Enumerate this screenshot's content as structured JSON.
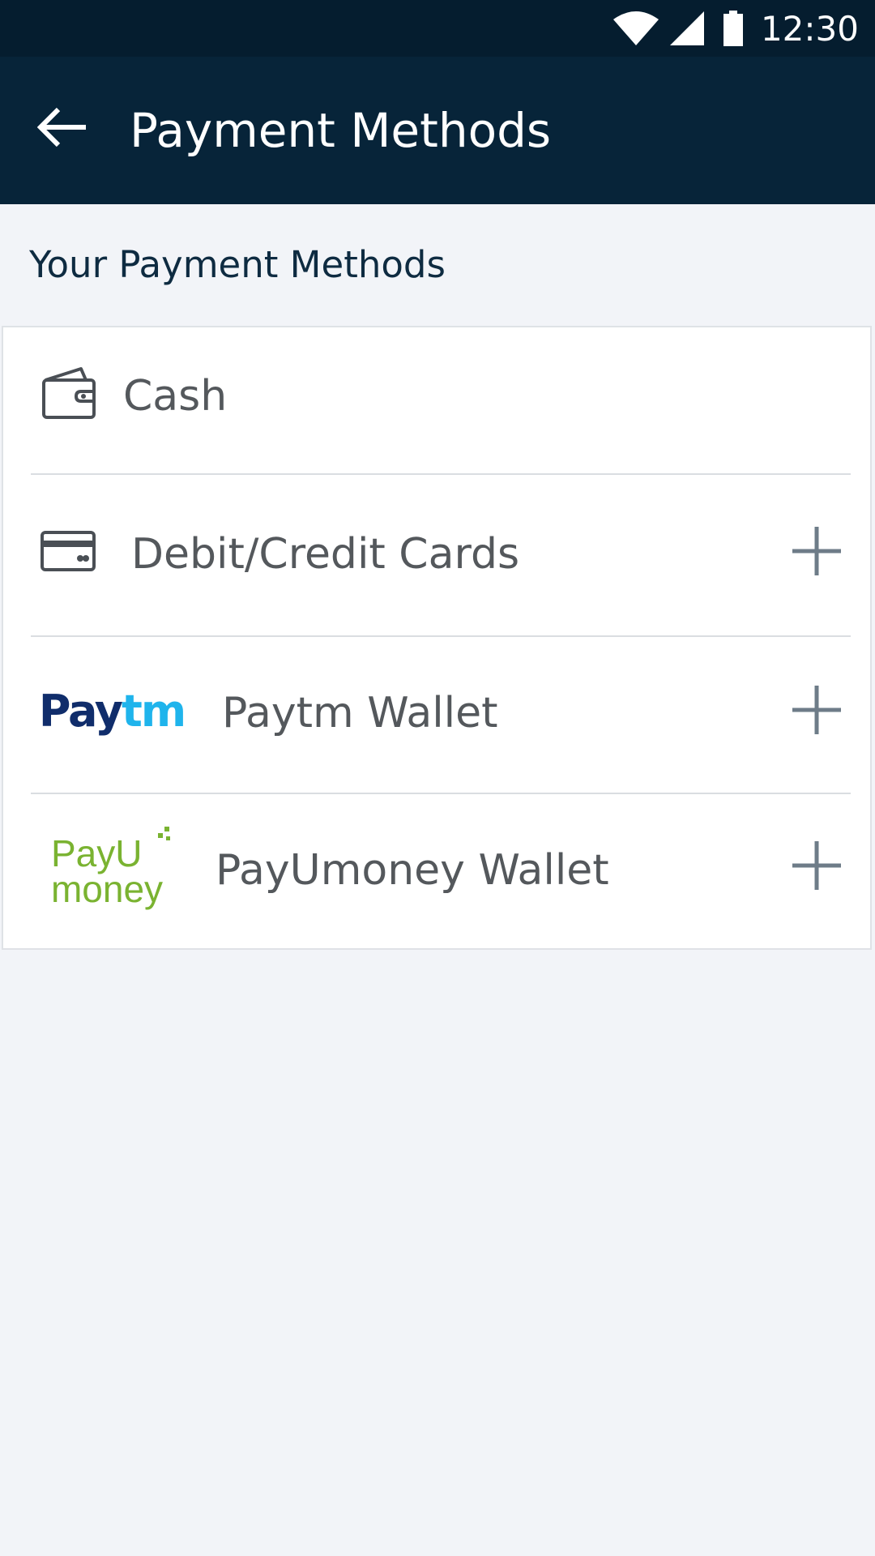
{
  "status_bar": {
    "time": "12:30",
    "icons": [
      "wifi-icon",
      "signal-icon",
      "battery-icon"
    ]
  },
  "app_bar": {
    "title": "Payment Methods",
    "back_icon": "arrow-left-icon"
  },
  "section": {
    "heading": "Your Payment Methods"
  },
  "methods": [
    {
      "label": "Cash",
      "icon": "wallet-icon",
      "has_add": false
    },
    {
      "label": "Debit/Credit Cards",
      "icon": "credit-card-icon",
      "has_add": true
    },
    {
      "label": "Paytm Wallet",
      "icon": "paytm-logo",
      "logo_text": [
        "Pay",
        "tm"
      ],
      "has_add": true
    },
    {
      "label": "PayUmoney Wallet",
      "icon": "payumoney-logo",
      "logo_text": [
        "PayU",
        "money"
      ],
      "has_add": true
    }
  ],
  "colors": {
    "status_bar": "#051d2f",
    "app_bar": "#072439",
    "background": "#f2f4f8",
    "heading": "#0e2b41",
    "row_text": "#54585c",
    "add_icon": "#6e7c88",
    "paytm_dark": "#102d6b",
    "paytm_light": "#1fb4ec",
    "payu_green": "#7ab331"
  }
}
